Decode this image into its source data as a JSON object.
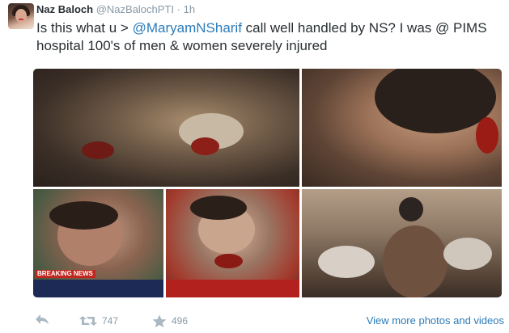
{
  "tweet": {
    "author_name": "Naz Baloch",
    "author_handle": "@NazBalochPTI",
    "separator": "·",
    "time": "1h",
    "text_before_mention": "Is this what u > ",
    "mention": "@MaryamNSharif",
    "text_after_mention": " call well handled by NS? I was @ PIMS hospital 100's of men & women severely injured"
  },
  "media": {
    "photos": [
      {
        "icon": "photo-injured-man-on-ground"
      },
      {
        "icon": "photo-injured-face-closeup"
      },
      {
        "icon": "photo-injured-man-news"
      },
      {
        "icon": "photo-injured-woman-news"
      },
      {
        "icon": "photo-hospital-ward"
      }
    ],
    "news_tag": "BREAKING NEWS"
  },
  "actions": {
    "retweet_count": "747",
    "favorite_count": "496",
    "view_more_label": "View more photos and videos"
  },
  "colors": {
    "link": "#2b7bb9",
    "meta": "#8899a6",
    "text": "#292f33"
  }
}
